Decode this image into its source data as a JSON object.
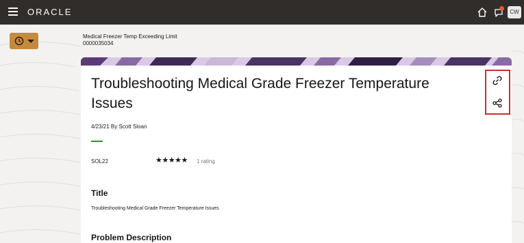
{
  "header": {
    "logo_text": "ORACLE",
    "avatar_initials": "CW",
    "icons": {
      "menu": "hamburger-menu-icon",
      "home": "home-icon",
      "notifications": "notifications-icon"
    },
    "accent_notification": "#e55b2a"
  },
  "subheader": {
    "title": "Medical Freezer Temp Exceeding Limit",
    "id": "0000035034",
    "recent_button_icon": "clock-icon",
    "recent_button_color": "#c68a3b"
  },
  "article": {
    "title": "Troubleshooting Medical Grade Freezer Temperature Issues",
    "meta": "4/23/21  By Scott Sloan",
    "solution_id": "SOL22",
    "stars": "★★★★★",
    "rating_value": 5,
    "rating_text": "1 rating",
    "actions": {
      "copy_link_icon": "link-icon",
      "share_icon": "share-icon"
    },
    "highlight_color": "#d12b2b",
    "accent_rule_color": "#2f8a2f"
  },
  "sections": {
    "title_label": "Title",
    "title_value": "Troubleshooting Medical Grade Freezer Temperature Issues",
    "problem_label": "Problem Description"
  }
}
